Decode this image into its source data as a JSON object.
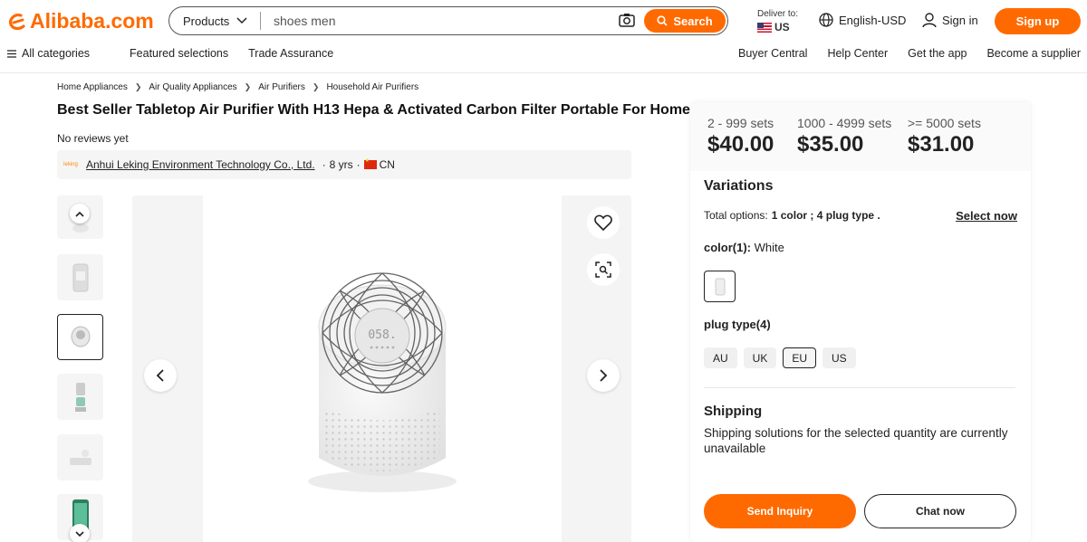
{
  "brand": {
    "logo_text": "Alibaba.com",
    "accent": "#ff6a00"
  },
  "search": {
    "category": "Products",
    "query": "shoes men",
    "button": "Search"
  },
  "header": {
    "deliver_label": "Deliver to:",
    "deliver_country": "US",
    "language": "English-USD",
    "sign_in": "Sign in",
    "sign_up": "Sign up"
  },
  "nav": {
    "all_categories": "All categories",
    "featured": "Featured selections",
    "trade_assurance": "Trade Assurance",
    "buyer_central": "Buyer Central",
    "help_center": "Help Center",
    "get_app": "Get the app",
    "become_supplier": "Become a supplier"
  },
  "breadcrumb": [
    "Home Appliances",
    "Air Quality Appliances",
    "Air Purifiers",
    "Household Air Purifiers"
  ],
  "product": {
    "title": "Best Seller Tabletop Air Purifier With H13 Hepa & Activated Carbon Filter Portable For Home",
    "reviews": "No reviews yet",
    "supplier_logo": "leking",
    "supplier_name": "Anhui Leking Environment Technology Co., Ltd.",
    "years": "8 yrs",
    "country": "CN",
    "display_reading": "058."
  },
  "pricing": [
    {
      "range": "2 - 999 sets",
      "price": "$40.00"
    },
    {
      "range": "1000 - 4999 sets",
      "price": "$35.00"
    },
    {
      "range": ">= 5000 sets",
      "price": "$31.00"
    }
  ],
  "variations": {
    "heading": "Variations",
    "total_label": "Total options:",
    "total_value": "1 color ; 4 plug type .",
    "select_now": "Select now",
    "color_label": "color(1):",
    "color_value": "White",
    "plug_label": "plug type(4)",
    "plugs": [
      "AU",
      "UK",
      "EU",
      "US"
    ],
    "selected_plug": "EU"
  },
  "shipping": {
    "heading": "Shipping",
    "text": "Shipping solutions for the selected quantity are currently unavailable"
  },
  "actions": {
    "inquiry": "Send Inquiry",
    "chat": "Chat now"
  }
}
